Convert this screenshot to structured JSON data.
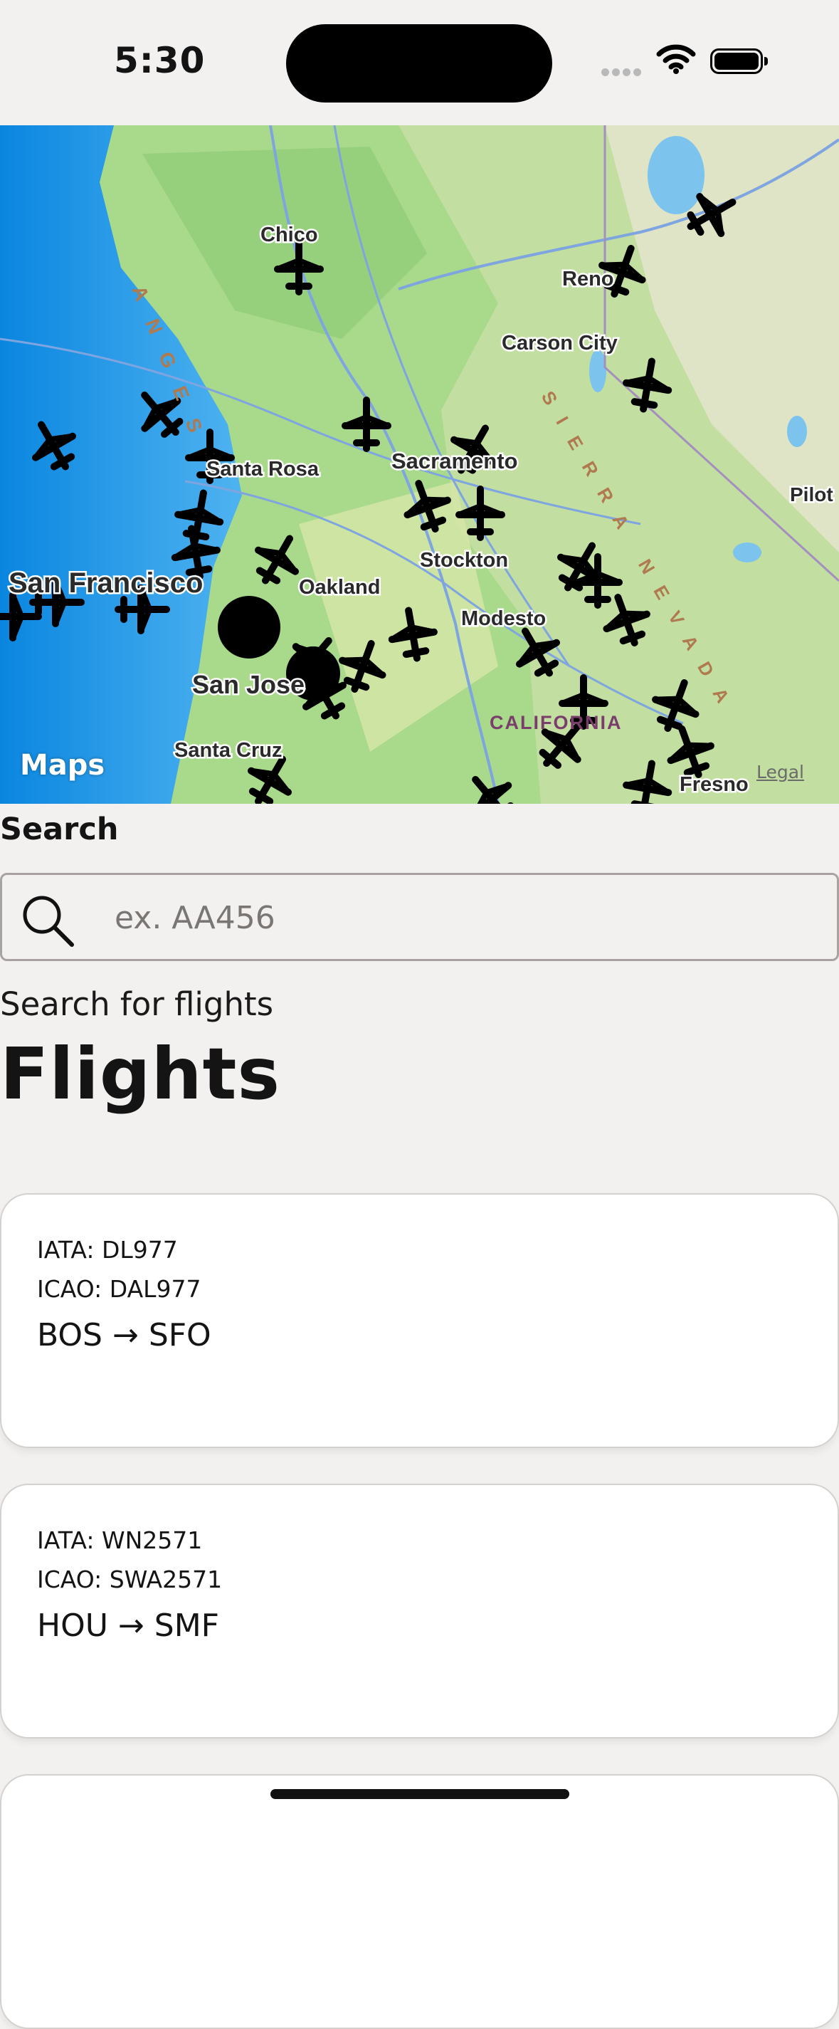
{
  "status_bar": {
    "time": "5:30"
  },
  "map": {
    "labels": {
      "chico": "Chico",
      "reno": "Reno",
      "carson_city": "Carson City",
      "santa_rosa": "Santa Rosa",
      "sacramento": "Sacramento",
      "pilot": "Pilot",
      "stockton": "Stockton",
      "san_francisco": "San Francisco",
      "oakland": "Oakland",
      "modesto": "Modesto",
      "san_jose": "San Jose",
      "california": "CALIFORNIA",
      "santa_cruz": "Santa Cruz",
      "fresno": "Fresno",
      "coast_ranges": "ANGES",
      "sierra_nevada": "SIERRA NEVADA"
    },
    "attribution": "Maps",
    "legal": "Legal"
  },
  "search": {
    "label": "Search",
    "placeholder": "ex. AA456",
    "value": ""
  },
  "subtitle": "Search for flights",
  "title": "Flights",
  "flights": [
    {
      "iata": "IATA: DL977",
      "icao": "ICAO: DAL977",
      "route": "BOS → SFO"
    },
    {
      "iata": "IATA: WN2571",
      "icao": "ICAO: SWA2571",
      "route": "HOU → SMF"
    }
  ],
  "icons": [
    "search-icon",
    "airplane-icon",
    "wifi-icon",
    "battery-icon",
    "apple-logo-icon"
  ]
}
